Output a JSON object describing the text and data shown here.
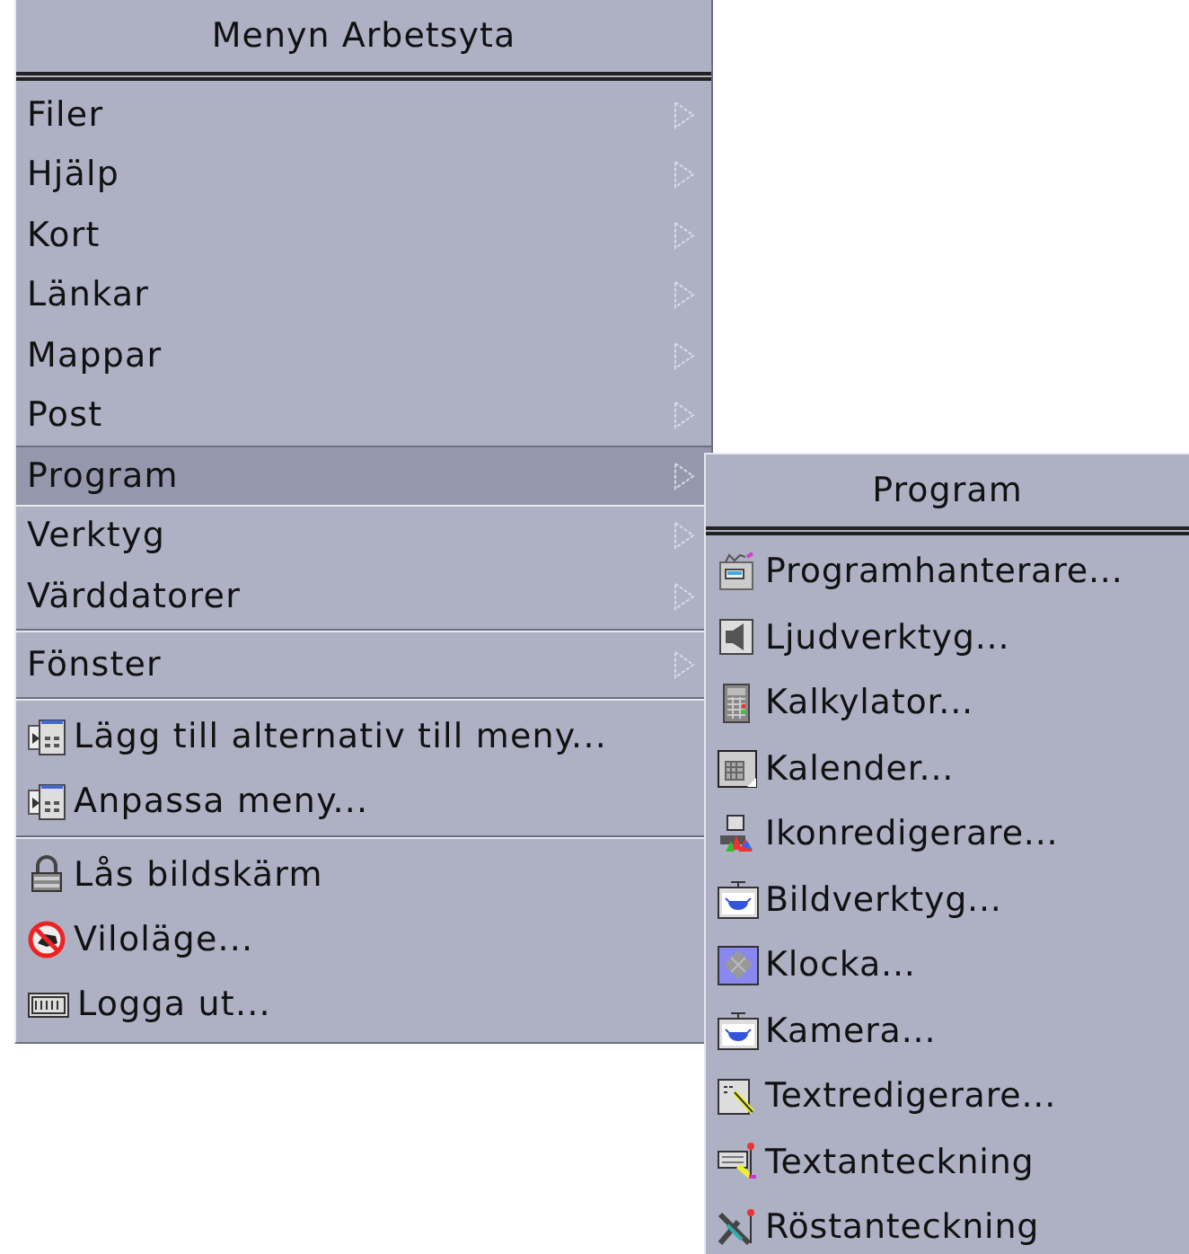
{
  "main_menu": {
    "title": "Menyn Arbetsyta",
    "groups": [
      {
        "items": [
          {
            "label": "Filer",
            "kind": "submenu",
            "selected": false
          },
          {
            "label": "Hjälp",
            "kind": "submenu",
            "selected": false
          },
          {
            "label": "Kort",
            "kind": "submenu",
            "selected": false
          },
          {
            "label": "Länkar",
            "kind": "submenu",
            "selected": false
          },
          {
            "label": "Mappar",
            "kind": "submenu",
            "selected": false
          },
          {
            "label": "Post",
            "kind": "submenu",
            "selected": false
          },
          {
            "label": "Program",
            "kind": "submenu",
            "selected": true
          },
          {
            "label": "Verktyg",
            "kind": "submenu",
            "selected": false
          },
          {
            "label": "Värddatorer",
            "kind": "submenu",
            "selected": false
          }
        ]
      },
      {
        "items": [
          {
            "label": "Fönster",
            "kind": "submenu",
            "selected": false
          }
        ]
      },
      {
        "items": [
          {
            "label": "Lägg till alternativ till meny...",
            "kind": "command",
            "selected": false
          },
          {
            "label": "Anpassa meny...",
            "kind": "command",
            "selected": false
          }
        ]
      },
      {
        "items": [
          {
            "label": "Lås bildskärm",
            "kind": "command",
            "selected": false
          },
          {
            "label": "Viloläge...",
            "kind": "command",
            "selected": false
          },
          {
            "label": "Logga ut...",
            "kind": "command",
            "selected": false
          }
        ]
      }
    ]
  },
  "submenu": {
    "title": "Program",
    "items": [
      {
        "label": "Programhanterare..."
      },
      {
        "label": "Ljudverktyg..."
      },
      {
        "label": "Kalkylator..."
      },
      {
        "label": "Kalender..."
      },
      {
        "label": "Ikonredigerare..."
      },
      {
        "label": "Bildverktyg..."
      },
      {
        "label": "Klocka..."
      },
      {
        "label": "Kamera..."
      },
      {
        "label": "Textredigerare..."
      },
      {
        "label": "Textanteckning"
      },
      {
        "label": "Röstanteckning"
      }
    ]
  }
}
